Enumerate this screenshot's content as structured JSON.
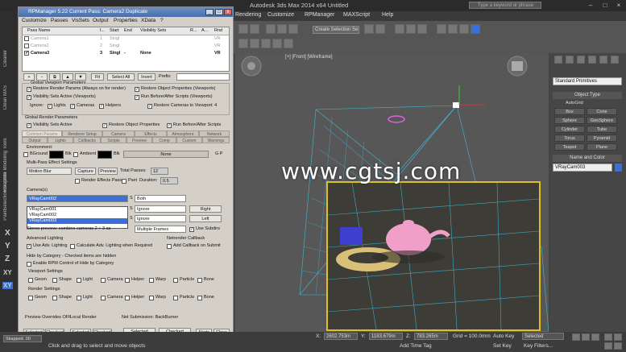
{
  "max": {
    "title": "Autodesk 3ds Max  2014 x64        Untitled",
    "search_placeholder": "Type a keyword or phrase",
    "menu": [
      "Rendering",
      "Customize",
      "RPManager",
      "MAXScript",
      "Help"
    ],
    "selection_set": "Create Selection Se",
    "viewport_label": "[+] [Front] [Wireframe]",
    "watermark": "www.cgtsj.com",
    "left_strip_labels": [
      "Cleaner",
      "Clean MXS",
      "Graphite Modeling Tools",
      "Freeform",
      "Selection",
      "Paint"
    ],
    "axes": [
      "X",
      "Y",
      "Z",
      "XY",
      "XY"
    ]
  },
  "command_panel": {
    "dropdown": "Standard Primitives",
    "object_type_header": "Object Type",
    "autogrid": "AutoGrid",
    "objects": [
      "Box",
      "Cone",
      "Sphere",
      "GeoSphere",
      "Cylinder",
      "Tube",
      "Torus",
      "Pyramid",
      "Teapot",
      "Plane"
    ],
    "name_color_header": "Name and Color",
    "name_value": "VRayCam003",
    "accent": "#3a6fd8"
  },
  "rpm": {
    "title": "RPManager 5.22   Current Pass: Camera2 Duplicate",
    "menu": [
      "Customize",
      "Passes",
      "VisSets",
      "Output",
      "Properties",
      "XData",
      "?"
    ],
    "table_headers": [
      "Pass Name",
      "I...",
      "Start",
      "End",
      "Visibility Sets",
      "R...",
      "A...",
      "Rnd"
    ],
    "passes": [
      {
        "name": "Camera1",
        "num": "1",
        "start": "Singl",
        "end": "",
        "vis": "",
        "rnd": "VR",
        "state": "dim"
      },
      {
        "name": "Camera2",
        "num": "2",
        "start": "Singl",
        "end": "",
        "vis": "",
        "rnd": "VR",
        "state": "dim"
      },
      {
        "name": "Camera3",
        "num": "3",
        "start": "Singl",
        "end": "-",
        "vis": "None",
        "rnd": "VR",
        "state": "active"
      }
    ],
    "fit": "Fit",
    "select_all": "Select All",
    "invert": "Invert",
    "prefix": "Prefix:",
    "global_viewport": "Global Viewport Parameters",
    "gv_opts": [
      "Restore Render Params (Always on for render)",
      "Restore Object Properties (Viewports)",
      "Visibility Sets Active (Viewports)",
      "Run Before/After Scripts (Viewports)"
    ],
    "ignore": "Ignore:",
    "ignore_items": [
      "Lights",
      "Cameras",
      "Helpers"
    ],
    "restore_cameras": "Restore Cameras to Viewport: 4",
    "global_render": "Global Render Parameters",
    "gr_opts": [
      "Visibility Sets Active",
      "Restore Object Properties",
      "Run Before/After Scripts"
    ],
    "tabs1": [
      "Common Params",
      "Renderer Setup",
      "Camera",
      "Effects",
      "Atmosphere",
      "Network"
    ],
    "tabs2": [
      "Output",
      "Lights",
      "Callbacks",
      "Scripts",
      "Preview",
      "Comp",
      "Custom",
      "Warnings"
    ],
    "environment": "Environment:",
    "bground": "BGround",
    "blk": "Blk",
    "ambient": "Ambient",
    "none": "None",
    "gp": "G  P",
    "multipass": "Multi-Pass Effect Settings",
    "motion_blur": "Motion Blur",
    "capture": "Capture",
    "preview": "Preview",
    "total_passes": "Total Passes:",
    "total_passes_val": "12",
    "duration": "Duration:",
    "duration_val": "0.5",
    "render_effects": "Render Effects Pass",
    "pset": "Pset",
    "cameras_label": "Camera(s)",
    "camera_selected": "VRayCam002",
    "camera_options": [
      "VRayCam001",
      "VRayCam002",
      "VRayCam003"
    ],
    "cam_rows": [
      "Both",
      "Ignore",
      "Ignore"
    ],
    "right": "Right",
    "left": "Left",
    "stereo": "Stereo preview: combine cameras 2 + 3 as",
    "multiple_frames": "Multiple Frames",
    "use_subdirs": "Use Subdirs",
    "adv_lighting": "Advanced Lighting",
    "netrender": "Netrender Callback",
    "use_adv": "Use Adv. Lighting",
    "calc_adv": "Calculate Adv. Lighting when Required",
    "add_callback": "Add Callback on Submit",
    "hide_cat": "Hide by Category - Checked items are hidden",
    "enable_rpm": "Enable RPM Control of Hide by Category",
    "viewport_settings": "Viewport Settings",
    "render_settings": "Render Settings",
    "cat_items": [
      "Geom",
      "Shape",
      "Light",
      "Camera",
      "Helper",
      "Warp",
      "Particle",
      "Bone"
    ],
    "preview_overrides": "Preview Overrides OFF",
    "local_render": "Local Render",
    "net_submission": "Net Submission: BackBurner",
    "selected": "Selected",
    "checked": "Checked",
    "alerts": "Alerts",
    "close": "Close"
  },
  "status": {
    "message": "Click and drag to select and move objects",
    "x_label": "X:",
    "x_val": "2602.753m",
    "y_label": "Y:",
    "y_val": "1183.679m",
    "z_label": "Z:",
    "z_val": "783.265m",
    "grid": "Grid = 100.0mm",
    "auto_key": "Auto Key",
    "selected": "Selected",
    "set_key": "Set Key",
    "key_filters": "Key Filters...",
    "add_time_tag": "Add Time Tag",
    "script_prompt": "Skapped. 00"
  }
}
